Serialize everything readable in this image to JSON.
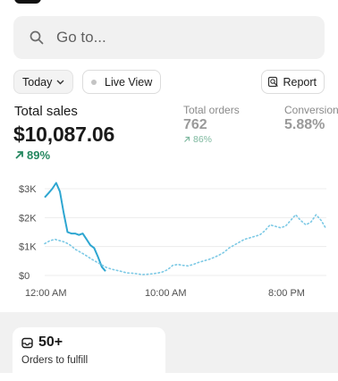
{
  "search": {
    "placeholder": "Go to..."
  },
  "filters": {
    "date_label": "Today",
    "live_view_label": "Live View",
    "report_label": "Report"
  },
  "metrics": {
    "total_sales": {
      "label": "Total sales",
      "value": "$10,087.06",
      "change": "89%"
    },
    "total_orders": {
      "label": "Total orders",
      "value": "762",
      "change": "86%"
    },
    "conversion": {
      "label": "Conversion",
      "value": "5.88%"
    }
  },
  "chart_data": {
    "type": "line",
    "y_ticks": [
      "$3K",
      "$2K",
      "$1K",
      "$0"
    ],
    "x_ticks": [
      "12:00 AM",
      "10:00 AM",
      "8:00 PM"
    ],
    "ylim": [
      0,
      3000
    ],
    "grid": true,
    "series": [
      {
        "style": "solid",
        "color": "#2ea6d1",
        "values": [
          2700,
          2850,
          3000,
          3200,
          2900,
          2150,
          1500,
          1450,
          1450,
          1400,
          1450,
          1250,
          1050,
          950,
          650,
          300,
          150
        ]
      },
      {
        "style": "dotted",
        "color": "#7cc9e5",
        "values": [
          1100,
          1200,
          1250,
          1200,
          1150,
          1050,
          900,
          800,
          700,
          580,
          480,
          380,
          280,
          220,
          180,
          140,
          90,
          80,
          60,
          30,
          40,
          60,
          80,
          120,
          200,
          350,
          380,
          350,
          330,
          380,
          450,
          500,
          550,
          620,
          700,
          800,
          950,
          1050,
          1150,
          1250,
          1300,
          1350,
          1400,
          1550,
          1750,
          1700,
          1650,
          1700,
          1900,
          2100,
          1900,
          1750,
          1850,
          2100,
          1900,
          1600
        ]
      }
    ]
  },
  "fulfill_card": {
    "count": "50+",
    "label": "Orders to fulfill"
  }
}
